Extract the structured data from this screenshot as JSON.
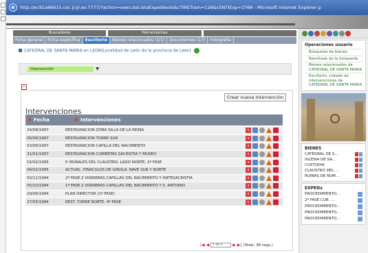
{
  "browser": {
    "title": "http://ec91a86615.cec.jcyl.es:7777/?action=executeListaExpediente&cTIRETram=126&cENTIExp=2768 - Microsoft Internet Explorer p"
  },
  "menubar": [
    "Buscadores",
    "Herramientas",
    ""
  ],
  "tabs": [
    {
      "label": "Ficha general",
      "active": false
    },
    {
      "label": "Ficha específica",
      "active": false
    },
    {
      "label": "Escritorio",
      "active": true
    },
    {
      "label": "Bienes relacionados (1/1)",
      "active": false
    },
    {
      "label": "Documentos (17)",
      "active": false
    },
    {
      "label": "Fotografía",
      "active": false
    }
  ],
  "location_text": "CATEDRAL DE SANTA MARIA en LEON(Localidad de León de la provincia de León)",
  "filter": {
    "selected": "Intervención"
  },
  "panel": {
    "new_button": "Crear nueva Intervención",
    "title": "Intervenciones",
    "col_fecha": "Fecha",
    "col_intervenciones": "Intervenciones",
    "rows": [
      {
        "date": "24/08/1997",
        "text": "RESTAURACION ZONA SILLA DE LA REINA"
      },
      {
        "date": "06/06/1997",
        "text": "RESTAURACION TORRE SUR"
      },
      {
        "date": "03/06/1997",
        "text": "RESTAURACION CAPILLA DEL NACIMIENTO"
      },
      {
        "date": "31/01/1997",
        "text": "RESTAURACION CUBIERTAS SACRISTIA Y MUSEO"
      },
      {
        "date": "15/02/1995",
        "text": "P. MURALES DEL CLAUSTRO. LADO NORTE, 2ª FASE"
      },
      {
        "date": "06/02/1995",
        "text": "ACTUAC. PINACULOS DE GIROLA. NAVE SUR Y NORTE"
      },
      {
        "date": "03/11/1994",
        "text": "2ª FASE.2 VIDRIERAS CAPILLAS DEL NACIMIENTO Y ANTESACRISTIA"
      },
      {
        "date": "05/10/1994",
        "text": "1ª FASE.2 VIDRIERAS CAPILLAS DEL NACIMIENTO Y S. ANTONIO"
      },
      {
        "date": "29/06/1994",
        "text": "PLAN DIRECTOR (1ª FASE)"
      },
      {
        "date": "27/05/1994",
        "text": "REST. TORRE NORTE. 4ª FASE"
      }
    ],
    "pager": {
      "page": "1 de 4",
      "total": "(Total: 36 regs.)"
    }
  },
  "sidebar": {
    "ops_title": "Operaciones usuario",
    "ops": [
      "Búsqueda de bienes",
      "Resultado de la búsqueda",
      "Bienes relacionados de CATEDRAL DE SANTA MARIA",
      "Escritorio: Listado de intervenciones de CATEDRAL DE SANTA MARIA"
    ],
    "bienes_title": "BIENES",
    "bienes": [
      "CATEDRAL DE S...",
      "IGLESIA DE SA...",
      "CUSTODIA",
      "CLAUSTRO DEL ...",
      "RUINAS DE NUM..."
    ],
    "exp_title": "EXPEDs",
    "exps": [
      "PROCEDIMIENTO...",
      "2ª FASE CUB. ...",
      "PROCEDIMIENTO...",
      "PROCEDIMIENTO...",
      "PROCEDIMIENTO..."
    ]
  }
}
